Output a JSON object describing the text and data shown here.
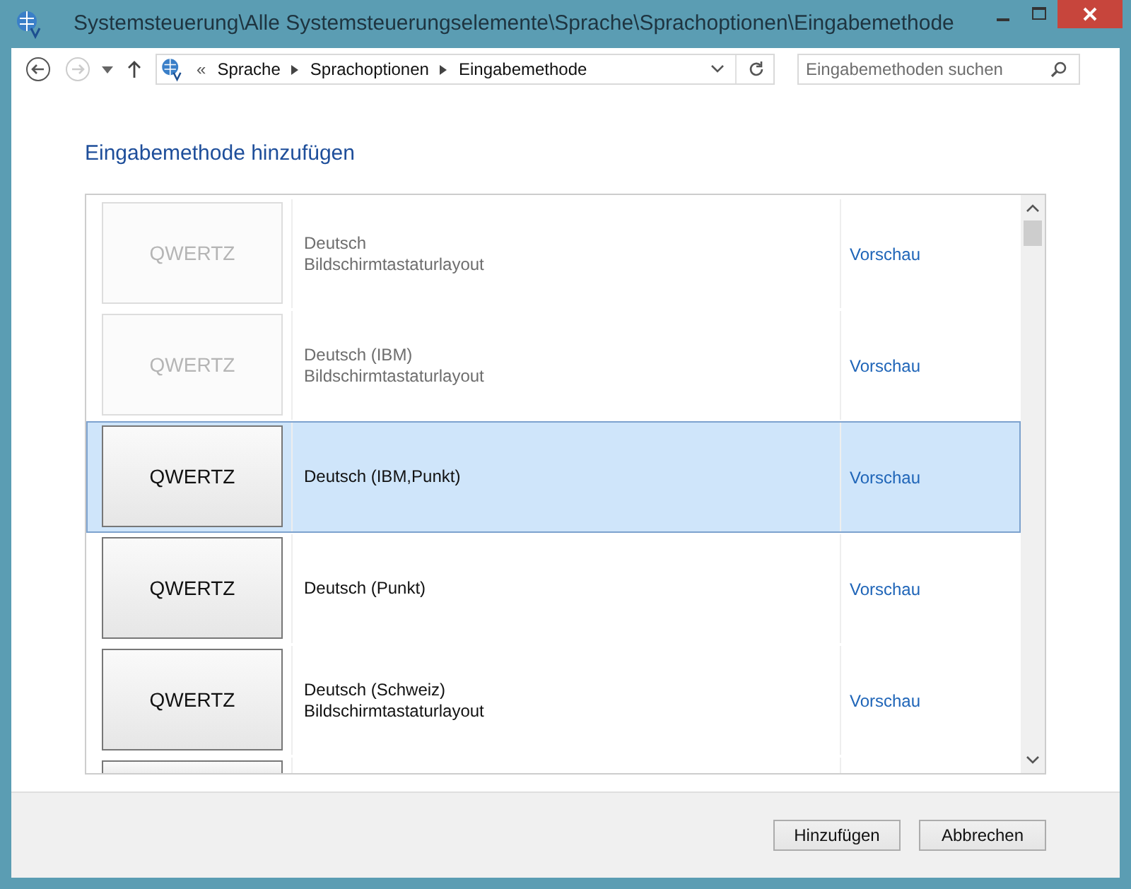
{
  "window": {
    "title": "Systemsteuerung\\Alle Systemsteuerungselemente\\Sprache\\Sprachoptionen\\Eingabemethode"
  },
  "address_bar": {
    "overflow": "«",
    "crumbs": [
      "Sprache",
      "Sprachoptionen",
      "Eingabemethode"
    ]
  },
  "search": {
    "placeholder": "Eingabemethoden suchen"
  },
  "heading": "Eingabemethode hinzufügen",
  "methods": [
    {
      "preview": "QWERTZ",
      "lines": [
        "Deutsch",
        "Bildschirmtastaturlayout"
      ],
      "link": "Vorschau",
      "disabled": true,
      "selected": false
    },
    {
      "preview": "QWERTZ",
      "lines": [
        "Deutsch (IBM)",
        "Bildschirmtastaturlayout"
      ],
      "link": "Vorschau",
      "disabled": true,
      "selected": false
    },
    {
      "preview": "QWERTZ",
      "lines": [
        "Deutsch (IBM,Punkt)"
      ],
      "link": "Vorschau",
      "disabled": false,
      "selected": true
    },
    {
      "preview": "QWERTZ",
      "lines": [
        "Deutsch (Punkt)"
      ],
      "link": "Vorschau",
      "disabled": false,
      "selected": false
    },
    {
      "preview": "QWERTZ",
      "lines": [
        "Deutsch (Schweiz)",
        "Bildschirmtastaturlayout"
      ],
      "link": "Vorschau",
      "disabled": false,
      "selected": false
    }
  ],
  "buttons": [
    "Hinzufügen",
    "Abbrechen"
  ]
}
